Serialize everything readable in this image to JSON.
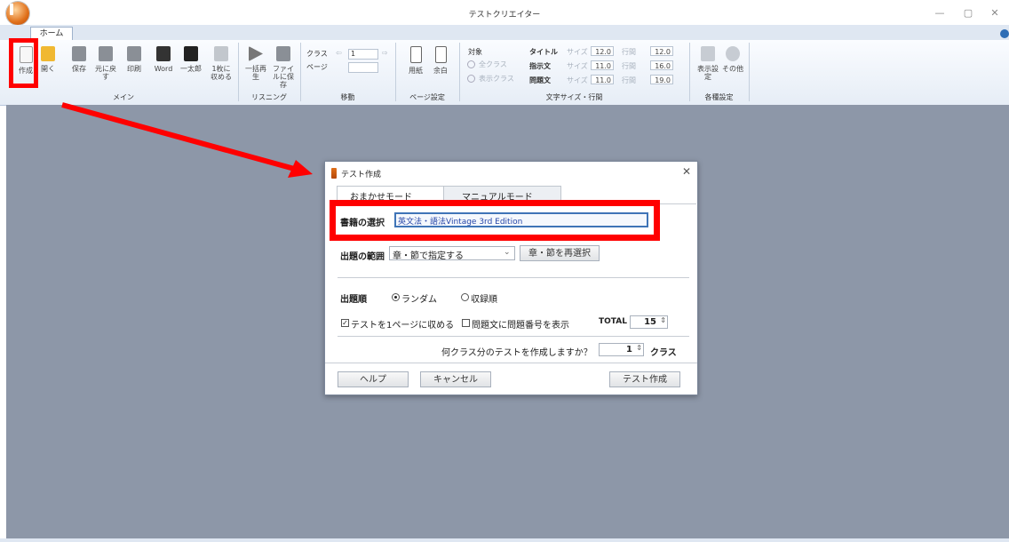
{
  "window": {
    "title": "テストクリエイター",
    "controls": [
      "—",
      "▢",
      "✕"
    ]
  },
  "ribbon": {
    "tab": "ホーム",
    "main_buttons": [
      {
        "label": "作成",
        "icon": "new-doc-icon"
      },
      {
        "label": "開く",
        "icon": "open-folder-icon"
      },
      {
        "label": "保存",
        "icon": "save-icon"
      },
      {
        "label": "元に戻す",
        "icon": "undo-icon"
      },
      {
        "label": "印刷",
        "icon": "print-icon"
      },
      {
        "label": "Word",
        "icon": "word-icon"
      },
      {
        "label": "一太郎",
        "icon": "ichitaro-icon"
      },
      {
        "label": "1枚に収める",
        "icon": "fit-page-icon"
      }
    ],
    "listening_buttons": [
      {
        "label": "一括再生",
        "icon": "play-icon"
      },
      {
        "label": "ファイルに保存",
        "icon": "save-audio-icon"
      }
    ],
    "nav": {
      "class_label": "クラス",
      "page_label": "ページ",
      "class_value": "1"
    },
    "page_setup": {
      "paper_label": "用紙",
      "margin_label": "余白"
    },
    "target": {
      "label": "対象",
      "opt_all": "全クラス",
      "opt_shown": "表示クラス"
    },
    "font_rows": [
      {
        "name": "タイトル",
        "size_label": "サイズ",
        "size": "12.0",
        "spacing_label": "行間",
        "spacing": "12.0"
      },
      {
        "name": "指示文",
        "size_label": "サイズ",
        "size": "11.0",
        "spacing_label": "行間",
        "spacing": "16.0"
      },
      {
        "name": "問題文",
        "size_label": "サイズ",
        "size": "11.0",
        "spacing_label": "行間",
        "spacing": "19.0"
      }
    ],
    "settings_buttons": [
      {
        "label": "表示設定",
        "icon": "display-settings-icon"
      },
      {
        "label": "その他",
        "icon": "gear-icon"
      }
    ],
    "groups": [
      "メイン",
      "リスニング",
      "移動",
      "ページ設定",
      "文字サイズ・行間",
      "各種設定"
    ]
  },
  "dialog": {
    "title": "テスト作成",
    "tabs": [
      "おまかせモード",
      "マニュアルモード"
    ],
    "book_label": "書籍の選択",
    "book_value": "英文法・語法Vintage 3rd Edition",
    "range_label": "出題の範囲",
    "range_value": "章・節で指定する",
    "reselect_button": "章・節を再選択",
    "order_label": "出題順",
    "order_random": "ランダム",
    "order_listed": "収録順",
    "fit_one_page": "テストを1ページに収める",
    "show_numbers": "問題文に問題番号を表示",
    "total_label": "TOTAL",
    "total_value": "15",
    "classes_question": "何クラス分のテストを作成しますか？",
    "classes_value": "1",
    "classes_unit": "クラス",
    "help_button": "ヘルプ",
    "cancel_button": "キャンセル",
    "create_button": "テスト作成"
  },
  "colors": {
    "highlight": "#ff0000",
    "workspace": "#8d97a8"
  }
}
